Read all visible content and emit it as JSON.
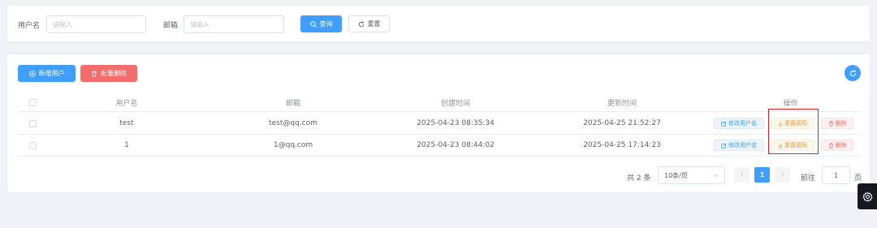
{
  "search": {
    "username_label": "用户名",
    "username_placeholder": "请输入",
    "username_value": "",
    "email_label": "邮箱",
    "email_placeholder": "请输入",
    "email_value": "",
    "query_label": "查询",
    "reset_label": "重置"
  },
  "toolbar": {
    "add_label": "新增用户",
    "batch_delete_label": "批量删除",
    "refresh_icon": "refresh-icon"
  },
  "table": {
    "columns": [
      "用户名",
      "邮箱",
      "创建时间",
      "更新时间",
      "操作"
    ],
    "rows": [
      {
        "username": "test",
        "email": "test@qq.com",
        "created": "2025-04-23 08:35:34",
        "updated": "2025-04-25 21:52:27",
        "selected": false
      },
      {
        "username": "1",
        "email": "1@qq.com",
        "created": "2025-04-23 08:44:02",
        "updated": "2025-04-25 17:14:23",
        "selected": false
      }
    ],
    "actions": {
      "edit_label": "修改用户名",
      "reset_password_label": "重置密码",
      "delete_label": "删除"
    }
  },
  "pagination": {
    "total_text": "共 2 条",
    "page_size": "10条/页",
    "current_page": "1",
    "goto_label": "前往",
    "goto_value": "1",
    "page_suffix": "页"
  },
  "colors": {
    "primary": "#409eff",
    "danger": "#f56c6c",
    "warning": "#e6a23c",
    "highlight_box": "#e02020"
  }
}
